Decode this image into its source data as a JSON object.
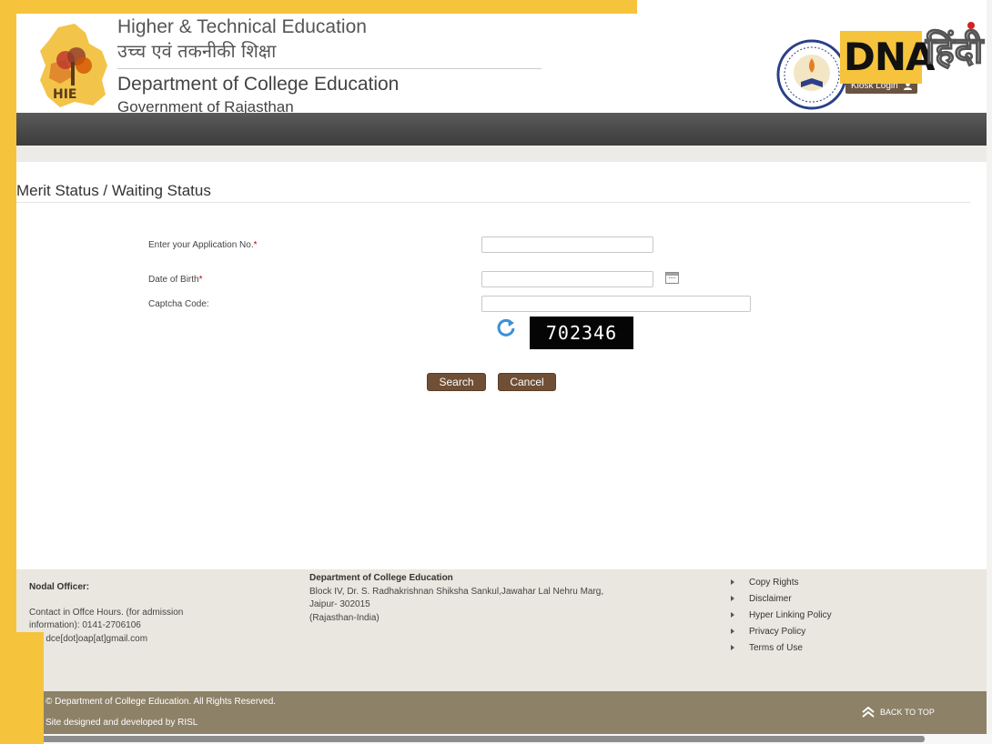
{
  "header": {
    "title_line1": "Higher & Technical Education",
    "title_hindi": "उच्च एवं तकनीकी शिक्षा",
    "department": "Department of College Education",
    "government": "Government of Rajasthan",
    "logo_letters": "HIE",
    "kiosk_label": "Kiosk Login",
    "watermark_latin": "DNA",
    "watermark_hindi": "हिंदी"
  },
  "form": {
    "page_title": "Merit Status / Waiting Status",
    "app_no_label": "Enter your Application No.",
    "dob_label": "Date of Birth",
    "captcha_label": "Captcha Code:",
    "required_mark": "*",
    "app_no_value": "",
    "dob_value": "",
    "captcha_value": "",
    "captcha_text": "702346",
    "search_label": "Search",
    "cancel_label": "Cancel"
  },
  "footer": {
    "nodal_title": "Nodal Officer:",
    "contact_line1": "Contact in Offce Hours. (for admission",
    "contact_line2": "information): 0141-2706106",
    "email": "ail : dce[dot]oap[at]gmail.com",
    "address_title": "Department of College Education",
    "address_line1": "Block IV, Dr. S. Radhakrishnan Shiksha Sankul,Jawahar Lal Nehru Marg,",
    "address_line2": "Jaipur- 302015",
    "address_line3": "(Rajasthan-India)",
    "links": [
      "Copy Rights",
      "Disclaimer",
      "Hyper Linking Policy",
      "Privacy Policy",
      "Terms of Use"
    ],
    "copyright": "© Department of College Education. All Rights Reserved.",
    "designed_by": "Site designed and developed by RISL",
    "back_to_top": "BACK TO TOP"
  },
  "colors": {
    "frame_yellow": "#f6c33c",
    "button_brown": "#6f4f35",
    "navbar_gray": "#4a4a4a",
    "footer_band": "#8d8168"
  },
  "icons": [
    "rajasthan-map-logo",
    "department-seal-icon",
    "user-icon",
    "calendar-icon",
    "refresh-icon",
    "back-to-top-icon"
  ]
}
